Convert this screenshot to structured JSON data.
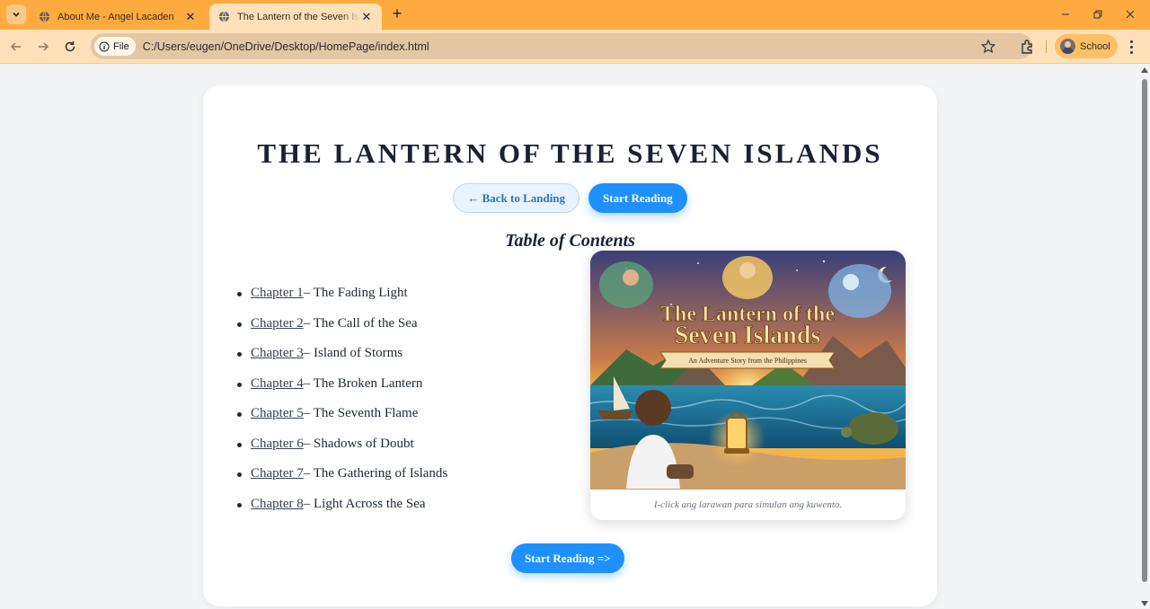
{
  "browser": {
    "tabs": [
      {
        "title": "About Me - Angel Lacaden",
        "active": false
      },
      {
        "title": "The Lantern of the Seven Islands",
        "active": true
      }
    ],
    "address": {
      "scheme_label": "File",
      "url": "C:/Users/eugen/OneDrive/Desktop/HomePage/index.html"
    },
    "profile_label": "School",
    "colors": {
      "tabbar": "#ffab40",
      "toolbar": "#ffe0b8"
    }
  },
  "page": {
    "title": "THE LANTERN OF THE SEVEN ISLANDS",
    "back_button": "← Back to Landing",
    "start_button": "Start Reading",
    "toc_heading": "Table of Contents",
    "chapters": [
      {
        "link": "Chapter 1",
        "name": " – The Fading Light"
      },
      {
        "link": "Chapter 2",
        "name": " – The Call of the Sea"
      },
      {
        "link": "Chapter 3",
        "name": " – Island of Storms"
      },
      {
        "link": "Chapter 4",
        "name": " – The Broken Lantern"
      },
      {
        "link": "Chapter 5",
        "name": " – The Seventh Flame"
      },
      {
        "link": "Chapter 6",
        "name": " – Shadows of Doubt"
      },
      {
        "link": "Chapter 7",
        "name": " – The Gathering of Islands"
      },
      {
        "link": "Chapter 8",
        "name": " – Light Across the Sea"
      }
    ],
    "cover": {
      "title_line1": "The Lantern of the",
      "title_line2": "Seven Islands",
      "subtitle": "An Adventure Story from the Philippines",
      "caption": "I-click ang larawan para simulan ang kuwento."
    },
    "bottom_button": "Start Reading =>",
    "colors": {
      "accent": "#1e90ff",
      "title": "#1a2133"
    }
  }
}
